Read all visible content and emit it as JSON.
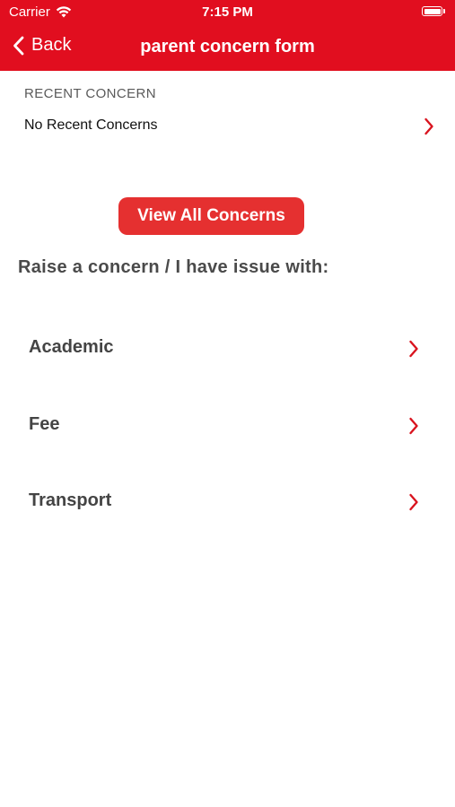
{
  "status_bar": {
    "carrier": "Carrier",
    "time": "7:15 PM",
    "wifi_icon": "wifi-icon",
    "battery_icon": "battery-icon"
  },
  "nav": {
    "back_label": "Back",
    "title": "parent concern form"
  },
  "recent": {
    "header": "RECENT CONCERN",
    "empty_label": "No Recent Concerns"
  },
  "view_all_label": "View All Concerns",
  "raise_label": "Raise a concern / I have issue with:",
  "issues": [
    {
      "label": "Academic"
    },
    {
      "label": "Fee"
    },
    {
      "label": "Transport"
    }
  ],
  "colors": {
    "brand_red": "#e10e1f",
    "button_red": "#e53030",
    "chevron_red": "#d9141f"
  }
}
